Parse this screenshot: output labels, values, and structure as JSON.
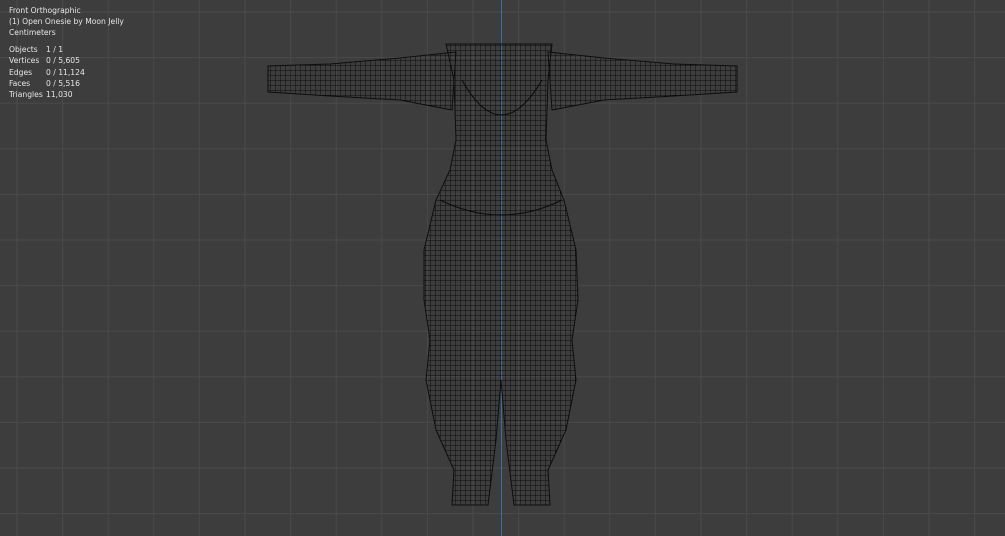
{
  "viewport": {
    "view_name": "Front Orthographic",
    "object_label": "(1) Open Onesie by Moon Jelly",
    "units": "Centimeters",
    "colors": {
      "background": "#3d3d3d",
      "grid_line": "#4a4a4a",
      "axis_line": "#3d6aa8",
      "mesh_wire": "#0d0d0d",
      "overlay_text": "#e6e6e6"
    }
  },
  "stats": [
    {
      "key": "Objects",
      "value": "1 / 1"
    },
    {
      "key": "Vertices",
      "value": "0 / 5,605"
    },
    {
      "key": "Edges",
      "value": "0 / 11,124"
    },
    {
      "key": "Faces",
      "value": "0 / 5,516"
    },
    {
      "key": "Triangles",
      "value": "11,030"
    }
  ]
}
